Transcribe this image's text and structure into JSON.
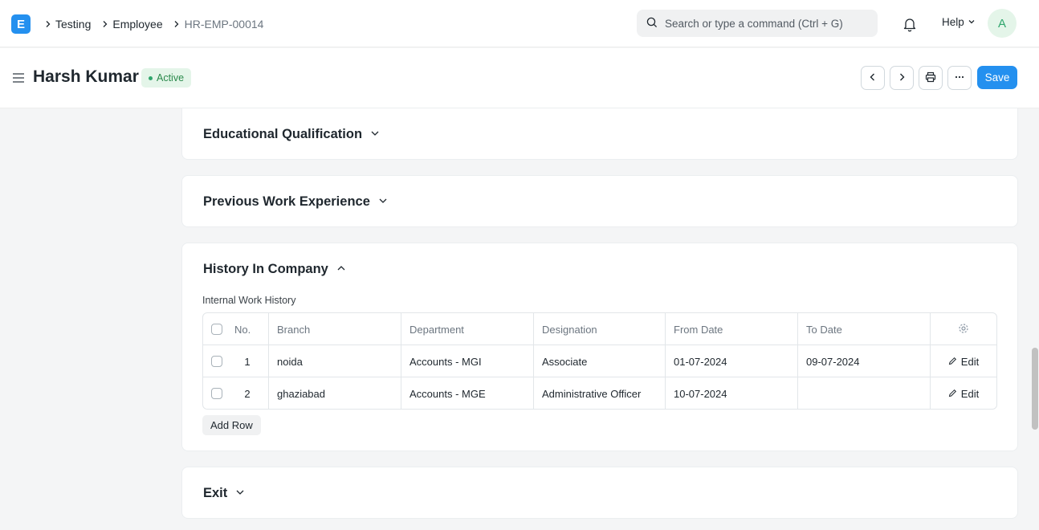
{
  "navbar": {
    "logo_letter": "E",
    "breadcrumbs": [
      "Testing",
      "Employee",
      "HR-EMP-00014"
    ],
    "search_placeholder": "Search or type a command (Ctrl + G)",
    "help_label": "Help",
    "avatar_letter": "A"
  },
  "page": {
    "title": "Harsh Kumar",
    "status": "Active",
    "save_label": "Save"
  },
  "sections": {
    "educational": "Educational Qualification",
    "previous_work": "Previous Work Experience",
    "history": "History In Company",
    "exit": "Exit"
  },
  "history": {
    "field_label": "Internal Work History",
    "columns": [
      "No.",
      "Branch",
      "Department",
      "Designation",
      "From Date",
      "To Date"
    ],
    "rows": [
      {
        "no": "1",
        "branch": "noida",
        "department": "Accounts - MGI",
        "designation": "Associate",
        "from_date": "01-07-2024",
        "to_date": "09-07-2024",
        "edit": "Edit"
      },
      {
        "no": "2",
        "branch": "ghaziabad",
        "department": "Accounts - MGE",
        "designation": "Administrative Officer",
        "from_date": "10-07-2024",
        "to_date": "",
        "edit": "Edit"
      }
    ],
    "add_row_label": "Add Row"
  },
  "colors": {
    "primary": "#2490ef",
    "success_bg": "#e4f5e9",
    "success_text": "#2b8a4c",
    "page_bg": "#f4f5f6"
  }
}
